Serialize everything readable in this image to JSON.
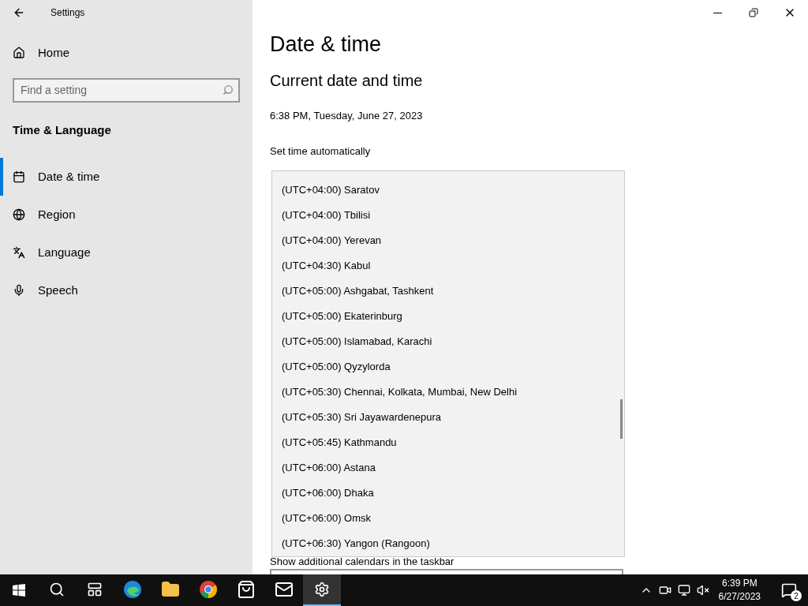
{
  "window": {
    "title": "Settings"
  },
  "sidebar": {
    "home": "Home",
    "search": {
      "placeholder": "Find a setting"
    },
    "section": "Time & Language",
    "items": [
      {
        "label": "Date & time",
        "kind": "calendar",
        "selected": true
      },
      {
        "label": "Region",
        "kind": "globe",
        "selected": false
      },
      {
        "label": "Language",
        "kind": "language",
        "selected": false
      },
      {
        "label": "Speech",
        "kind": "mic",
        "selected": false
      }
    ]
  },
  "page": {
    "title": "Date & time",
    "subtitle": "Current date and time",
    "current": "6:38 PM, Tuesday, June 27, 2023",
    "set_time_label": "Set time automatically",
    "calendars_label": "Show additional calendars in the taskbar"
  },
  "timezone_list": [
    "(UTC+04:00) Saratov",
    "(UTC+04:00) Tbilisi",
    "(UTC+04:00) Yerevan",
    "(UTC+04:30) Kabul",
    "(UTC+05:00) Ashgabat, Tashkent",
    "(UTC+05:00) Ekaterinburg",
    "(UTC+05:00) Islamabad, Karachi",
    "(UTC+05:00) Qyzylorda",
    "(UTC+05:30) Chennai, Kolkata, Mumbai, New Delhi",
    "(UTC+05:30) Sri Jayawardenepura",
    "(UTC+05:45) Kathmandu",
    "(UTC+06:00) Astana",
    "(UTC+06:00) Dhaka",
    "(UTC+06:00) Omsk",
    "(UTC+06:30) Yangon (Rangoon)"
  ],
  "taskbar": {
    "apps": [
      {
        "kind": "search",
        "selected": false
      },
      {
        "kind": "taskview",
        "selected": false
      },
      {
        "kind": "edge",
        "selected": false
      },
      {
        "kind": "explorer",
        "selected": false
      },
      {
        "kind": "chrome",
        "selected": false
      },
      {
        "kind": "store",
        "selected": false
      },
      {
        "kind": "mail",
        "selected": false
      },
      {
        "kind": "settings",
        "selected": true
      }
    ],
    "time": "6:39 PM",
    "date": "6/27/2023",
    "notifications": "2"
  }
}
